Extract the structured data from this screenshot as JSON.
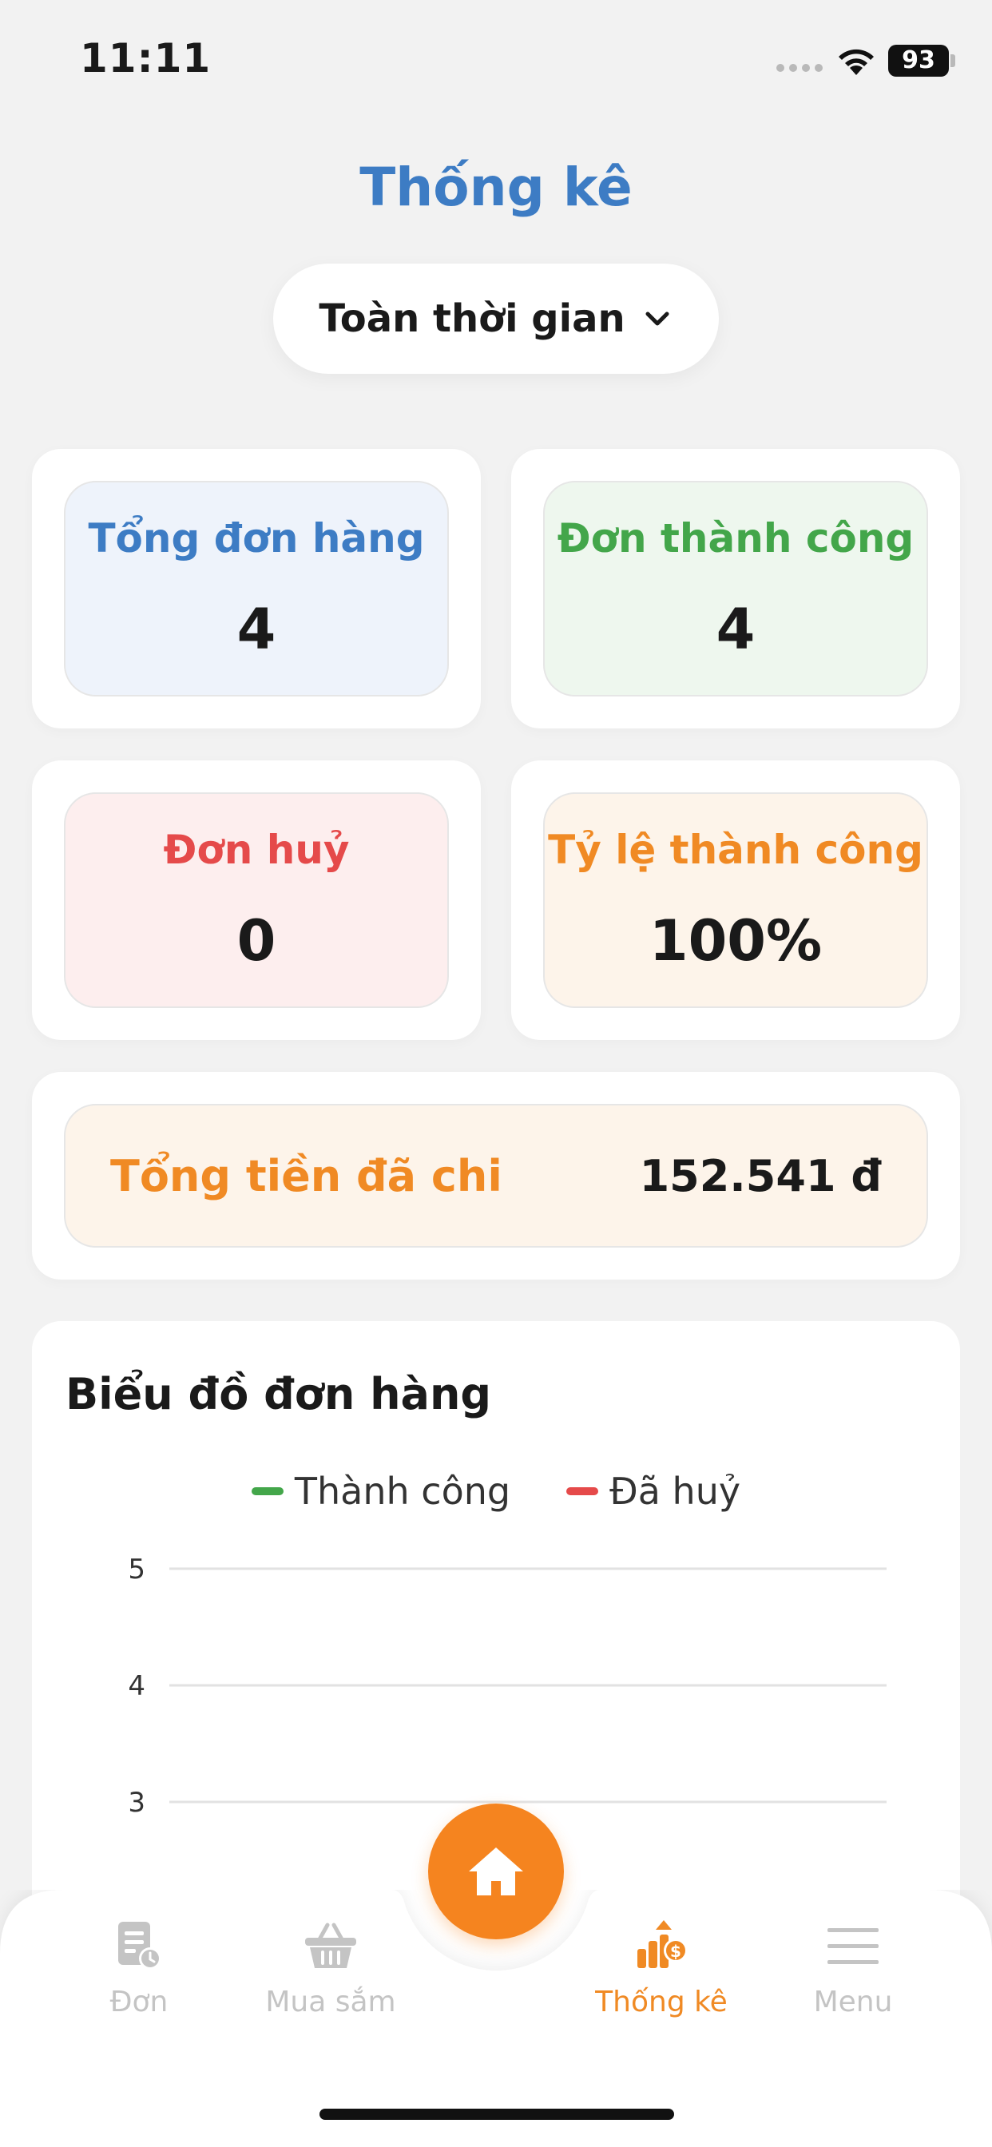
{
  "status": {
    "time": "11:11",
    "battery": "93"
  },
  "header": {
    "title": "Thống kê",
    "period": "Toàn thời gian"
  },
  "stats": {
    "total_orders": {
      "label": "Tổng đơn hàng",
      "value": "4"
    },
    "success_orders": {
      "label": "Đơn thành công",
      "value": "4"
    },
    "cancelled_orders": {
      "label": "Đơn huỷ",
      "value": "0"
    },
    "success_rate": {
      "label": "Tỷ lệ thành công",
      "value": "100%"
    }
  },
  "spent": {
    "label": "Tổng tiền đã chi",
    "value": "152.541 đ"
  },
  "chart_data": {
    "type": "line",
    "title": "Biểu đồ đơn hàng",
    "series": [
      {
        "name": "Thành công",
        "color": "#43a64a"
      },
      {
        "name": "Đã huỷ",
        "color": "#e54a4a"
      }
    ],
    "y_ticks": [
      "5",
      "4",
      "3"
    ],
    "grid": true,
    "legend_position": "top-center"
  },
  "nav": {
    "items": [
      {
        "label": "Đơn",
        "icon": "order-icon"
      },
      {
        "label": "Mua sắm",
        "icon": "basket-icon"
      },
      {
        "label": "Thống kê",
        "icon": "stats-icon"
      },
      {
        "label": "Menu",
        "icon": "menu-icon"
      }
    ],
    "center": {
      "icon": "home-icon"
    }
  },
  "colors": {
    "accent": "#f5841f",
    "title_blue": "#3d7cc4",
    "success": "#43a64a",
    "danger": "#e54a4a"
  }
}
